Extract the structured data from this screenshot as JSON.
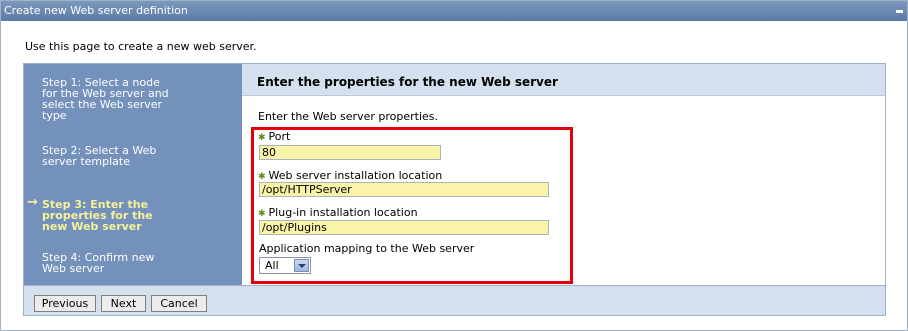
{
  "window": {
    "title": "Create new Web server definition"
  },
  "intro_text": "Use this page to create a new web server.",
  "steps": [
    {
      "label": "Step 1: Select a node for the Web server and select the Web server type"
    },
    {
      "label": "Step 2: Select a Web server template"
    },
    {
      "label": "Step 3: Enter the properties for the new Web server"
    },
    {
      "label": "Step 4: Confirm new Web server"
    }
  ],
  "current_step_index": 2,
  "form": {
    "header": "Enter the properties for the new Web server",
    "subtitle": "Enter the Web server properties.",
    "port": {
      "label": "Port",
      "value": "80",
      "required": true
    },
    "install_location": {
      "label": "Web server installation location",
      "value": "/opt/HTTPServer",
      "required": true
    },
    "plugin_location": {
      "label": "Plug-in installation location",
      "value": "/opt/Plugins",
      "required": true
    },
    "app_mapping": {
      "label": "Application mapping to the Web server",
      "selected": "All"
    }
  },
  "buttons": {
    "previous": "Previous",
    "next": "Next",
    "cancel": "Cancel"
  },
  "colors": {
    "titlebar": "#5b7aa6",
    "step_panel": "#7391bb",
    "current_step": "#f6f19a",
    "input_fill": "#f9f4a8",
    "highlight_border": "#e3000b"
  },
  "icons": {
    "required": "asterisk-icon",
    "current_step": "arrow-right-icon",
    "dropdown": "chevron-down-icon"
  }
}
